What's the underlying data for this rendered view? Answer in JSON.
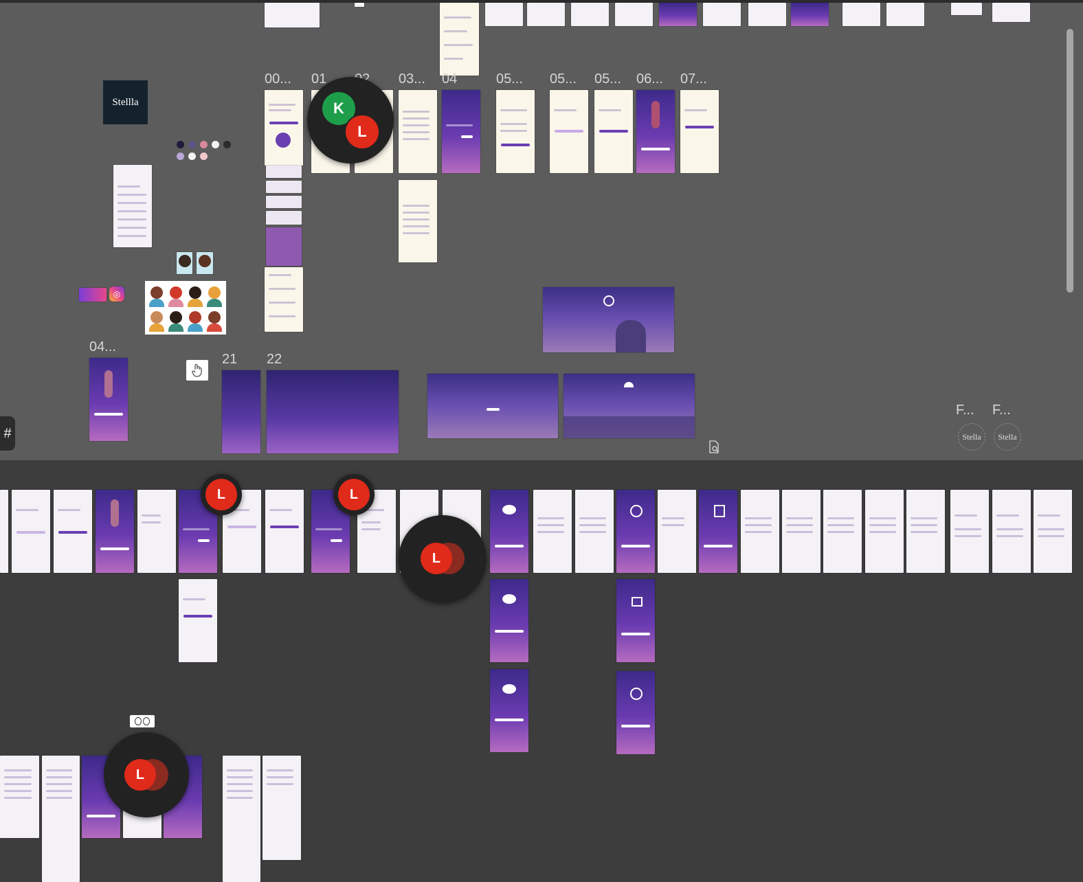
{
  "canvas": {
    "brand_logo_text": "Stellla",
    "round_logo_text": "Stella",
    "frame_labels": {
      "l00": "00...",
      "l01": "01",
      "l02": "02",
      "l03": "03...",
      "l04": "04",
      "l05a": "05...",
      "l05b": "05...",
      "l05c": "05...",
      "l06": "06...",
      "l07": "07...",
      "l04b": "04...",
      "l21": "21",
      "l22": "22",
      "lf1": "F...",
      "lf2": "F..."
    },
    "collaborators": {
      "k": "K",
      "l": "L"
    },
    "side_tab_icon": "#"
  },
  "palette": [
    "#1f1b3d",
    "#5c5488",
    "#d88a9a",
    "#f4f4f4",
    "#2a2a2a",
    "#b9a6d9",
    "#f3f3f3",
    "#f1c7cc"
  ],
  "icons": {
    "hand": "hand-pointer-icon",
    "search_doc": "document-search-icon",
    "eyes": "eyes-emoji-icon",
    "instagram": "instagram-icon"
  }
}
